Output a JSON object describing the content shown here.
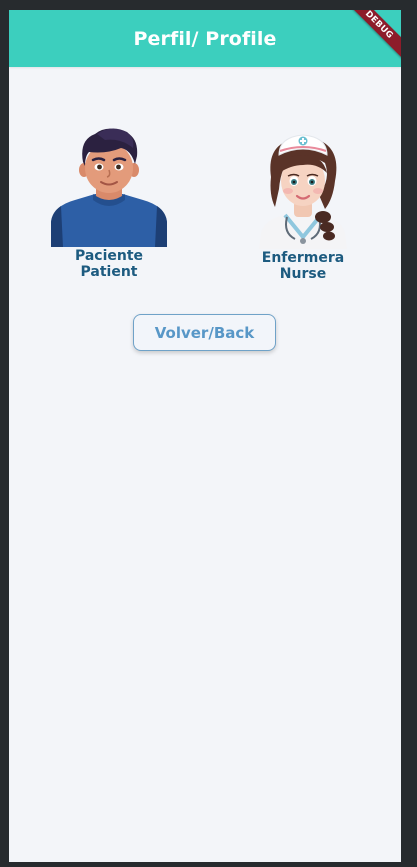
{
  "app_bar": {
    "title": "Perfil/ Profile",
    "color": "#3ccfbe",
    "debug_banner": "DEBUG"
  },
  "profiles": [
    {
      "icon": "patient-avatar",
      "line1": "Paciente",
      "line2": "Patient"
    },
    {
      "icon": "nurse-avatar",
      "line1": "Enfermera",
      "line2": "Nurse"
    }
  ],
  "back_button": {
    "label": "Volver/Back"
  },
  "colors": {
    "label_text": "#1d5b80",
    "button_text": "#5897c7",
    "background": "#f3f5f9"
  }
}
